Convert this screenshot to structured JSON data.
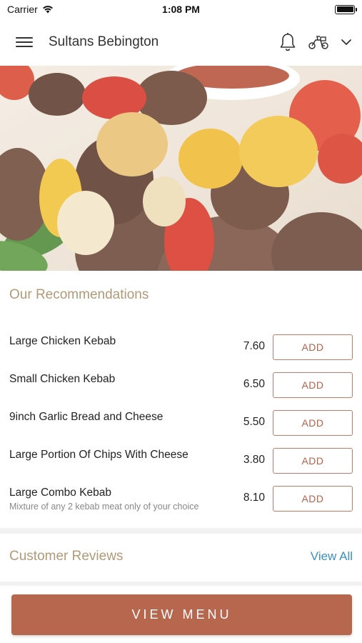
{
  "status_bar": {
    "carrier": "Carrier",
    "time": "1:08 PM",
    "battery_level": 1.0
  },
  "header": {
    "title": "Sultans Bebington",
    "icons": [
      "menu-icon",
      "bell-icon",
      "scooter-icon",
      "chevron-down-icon"
    ]
  },
  "hero": {
    "icon": "kebab-food-photo"
  },
  "recommendations": {
    "title": "Our Recommendations",
    "items": [
      {
        "name": "Large Chicken Kebab",
        "description": "",
        "price": "7.60",
        "button": "ADD"
      },
      {
        "name": "Small Chicken Kebab",
        "description": "",
        "price": "6.50",
        "button": "ADD"
      },
      {
        "name": "9inch Garlic Bread and Cheese",
        "description": "",
        "price": "5.50",
        "button": "ADD"
      },
      {
        "name": "Large Portion Of Chips With Cheese",
        "description": "",
        "price": "3.80",
        "button": "ADD"
      },
      {
        "name": "Large Combo Kebab",
        "description": "Mixture of any 2 kebab meat only of your choice",
        "price": "8.10",
        "button": "ADD"
      }
    ]
  },
  "reviews": {
    "title": "Customer Reviews",
    "view_all": "View All"
  },
  "footer": {
    "button": "VIEW MENU"
  },
  "colors": {
    "accent": "#b8674f",
    "section_title": "#b09a78",
    "link": "#3a8fbf"
  }
}
